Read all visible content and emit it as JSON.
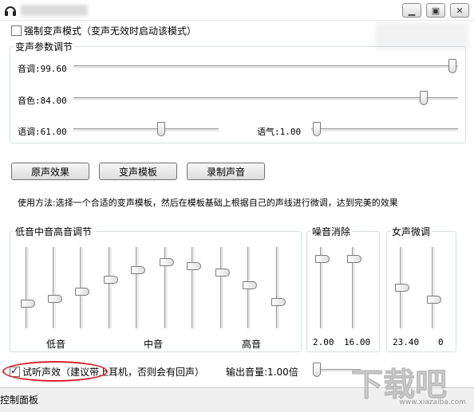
{
  "force_mode": {
    "label": "强制变声模式（变声无效时启动该模式）",
    "checked": false
  },
  "params": {
    "legend": "变声参数调节",
    "pitch": {
      "label": "音调:99.60",
      "value": 99.6
    },
    "timbre": {
      "label": "音色:84.00",
      "value": 84.0
    },
    "speed": {
      "label": "语调:61.00",
      "value": 61.0
    },
    "tone": {
      "label": "语气:1.00",
      "value": 1.0
    }
  },
  "buttons": {
    "original": "原声效果",
    "template": "变声模板",
    "record": "录制声音"
  },
  "usage": "使用方法:选择一个合适的变声模板，然后在模板基础上根据自己的声线进行微调，达到完美的效果",
  "eq": {
    "legend": "低音中音高音调节",
    "labels": [
      "低音",
      "中音",
      "高音"
    ],
    "levels": [
      0.3,
      0.36,
      0.45,
      0.6,
      0.72,
      0.81,
      0.76,
      0.69,
      0.53,
      0.32
    ]
  },
  "noise": {
    "legend": "噪音消除",
    "values": [
      "2.00",
      "16.00"
    ],
    "levels": [
      0.85,
      0.85
    ]
  },
  "female": {
    "legend": "女声微调",
    "values": [
      "23.40",
      "0"
    ],
    "levels": [
      0.5,
      0.35
    ]
  },
  "preview": {
    "label": "试听声效（建议带上耳机，否则会有回声）",
    "checked": true
  },
  "output": {
    "label": "输出音量:1.00倍",
    "level": 0.0
  },
  "statusbar": {
    "text": "控制面板"
  },
  "watermark": {
    "text": "下载吧",
    "sub": "www.xiazaiba.com"
  },
  "colors": {
    "highlight": "#d8232a"
  }
}
